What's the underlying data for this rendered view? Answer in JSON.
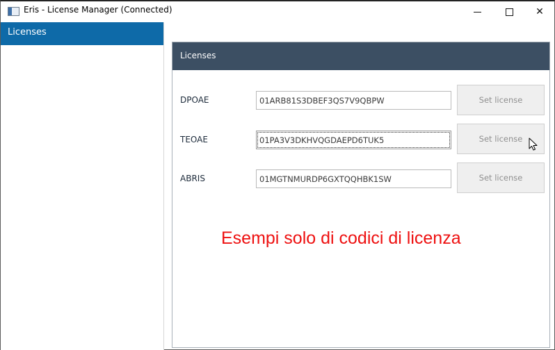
{
  "window": {
    "title": "Eris - License Manager (Connected)",
    "icon": "app-window-icon",
    "controls": {
      "minimize_icon": "minimize-icon",
      "maximize_icon": "maximize-icon",
      "close_icon": "close-icon",
      "close_glyph": "✕"
    }
  },
  "sidebar": {
    "items": [
      {
        "label": "Licenses",
        "selected": true
      }
    ],
    "selected_color": "#0e6aa8"
  },
  "main": {
    "header": {
      "title": "Licenses",
      "color": "#3c4f63"
    },
    "licenses": [
      {
        "name": "DPOAE",
        "value": "01ARB81S3DBEF3QS7V9QBPW",
        "button": "Set license",
        "focused": false
      },
      {
        "name": "TEOAE",
        "value": "01PA3V3DKHVQGDAEPD6TUK5",
        "button": "Set license",
        "focused": true
      },
      {
        "name": "ABRIS",
        "value": "01MGTNMURDP6GXTQQHBK1SW",
        "button": "Set license",
        "focused": false
      }
    ],
    "note": {
      "text": "Esempi solo di codici di licenza",
      "color": "#ee1010"
    }
  }
}
